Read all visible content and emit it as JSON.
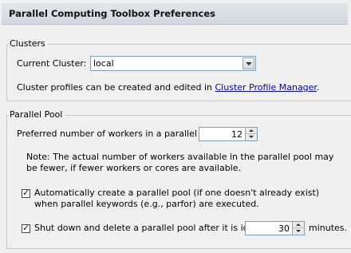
{
  "header": {
    "title": "Parallel Computing Toolbox Preferences"
  },
  "clusters": {
    "group_title": "Clusters",
    "current_cluster_label": "Current Cluster:",
    "current_cluster_value": "local",
    "profiles_text": "Cluster profiles can be created and edited in ",
    "profile_manager_link": "Cluster Profile Manager",
    "profiles_text_end": "."
  },
  "parallel_pool": {
    "group_title": "Parallel Pool",
    "preferred_workers_label": "Preferred number of workers in a parallel pool:",
    "preferred_workers_value": "12",
    "note_text": "Note: The actual number of workers available in the parallel pool may be fewer, if fewer workers or cores are available.",
    "auto_create_checked": true,
    "auto_create_label": "Automatically create a parallel pool (if one doesn't already exist) when parallel keywords (e.g., parfor) are executed.",
    "shutdown_checked": true,
    "shutdown_label": "Shut down and delete a parallel pool after it is idle for",
    "idle_minutes_value": "30",
    "minutes_label": "minutes."
  }
}
